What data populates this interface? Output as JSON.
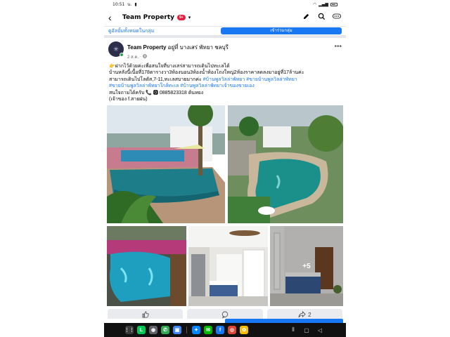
{
  "status": {
    "time": "10:51",
    "extra": "น."
  },
  "nav": {
    "title": "Team Property",
    "badge": "9+",
    "caret": "▾",
    "back_icon": "back-arrow-icon",
    "icons": [
      "pencil-icon",
      "search-icon",
      "more-horizontal-icon"
    ]
  },
  "prev_strip": {
    "left_text": "ดูอัลบั้มทั้งหมดในกลุ่ม",
    "button_label": "เข้าร่วมกลุ่ม"
  },
  "post": {
    "author": "Team Property",
    "location": "อยู่ที่ บางเสร่ พัทยา ชลบุรี",
    "date": "2 ส.ค.",
    "privacy_icon": "globe-icon",
    "more_label": "•••",
    "lines": [
      {
        "text": "👉ฝากไว้ด้วยค่ะเพื่อสนใจที่บางเสร่สามารถเดินไปทะเลได้",
        "link": false
      },
      {
        "text": "บ้านหลังนี้เนื้อที่178ตารางวา3ห้องนอน3ห้องน้ำห้องโถงใหญ่2ห้องราคาลดลงมาอยู่ที่17ล้านค่ะ",
        "link": false
      },
      {
        "text": "สามารถเดินไปโลตัส,7-11,ทะเลสบายมากค่ะ ",
        "link": false,
        "tag": "#บ้านพูลวิลล่าพัทยา #ขายบ้านพูลวิลล่าพัทยา"
      },
      {
        "text": "",
        "link": true,
        "tag": "#ขายบ้านพูลวิลล่าพัทยาใกล้ทะเล #บ้านพูลวิลล่าพัทยาเจ้าของขายเอง"
      },
      {
        "text": "สนใจถามได้ครับ 📞 🅾 0885823318 ต้นหยง",
        "link": false
      },
      {
        "text": "(เจ้าของ f.สายฝน)",
        "link": false
      }
    ],
    "extra_photos": "+5"
  },
  "actions": {
    "like_icon": "thumbs-up-icon",
    "comment_icon": "comment-icon",
    "share_icon": "share-icon",
    "share_count": "2"
  },
  "taskbar": {
    "apps": [
      {
        "name": "app-grid-icon",
        "color": "#3a3a3a",
        "glyph": "⋮⋮"
      },
      {
        "name": "line-app-icon",
        "color": "#06c755",
        "glyph": "L"
      },
      {
        "name": "camera-app-icon",
        "color": "#5f6368",
        "glyph": "◉"
      },
      {
        "name": "phone-app-icon",
        "color": "#34a853",
        "glyph": "✆"
      },
      {
        "name": "files-app-icon",
        "color": "#4285f4",
        "glyph": "▣"
      },
      {
        "name": "messenger-app-icon",
        "color": "#0084ff",
        "glyph": "✦"
      },
      {
        "name": "chat-app-icon",
        "color": "#00b900",
        "glyph": "✉"
      },
      {
        "name": "facebook-app-icon",
        "color": "#1877f2",
        "glyph": "f"
      },
      {
        "name": "chrome-app-icon",
        "color": "#db4437",
        "glyph": "◎"
      },
      {
        "name": "gallery-app-icon",
        "color": "#fbbc05",
        "glyph": "✿"
      }
    ]
  }
}
